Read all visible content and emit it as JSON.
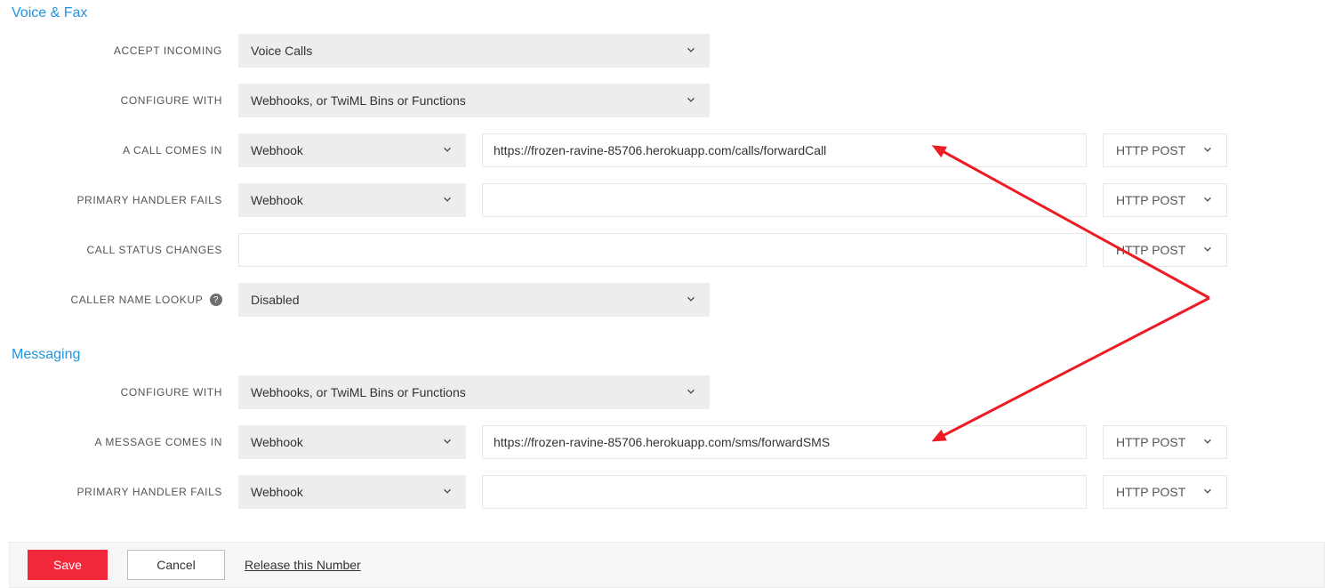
{
  "voice": {
    "title": "Voice & Fax",
    "accept_incoming": {
      "label": "ACCEPT INCOMING",
      "value": "Voice Calls"
    },
    "configure_with": {
      "label": "CONFIGURE WITH",
      "value": "Webhooks, or TwiML Bins or Functions"
    },
    "call_comes_in": {
      "label": "A CALL COMES IN",
      "type": "Webhook",
      "url": "https://frozen-ravine-85706.herokuapp.com/calls/forwardCall",
      "method": "HTTP POST"
    },
    "primary_handler_fails": {
      "label": "PRIMARY HANDLER FAILS",
      "type": "Webhook",
      "url": "",
      "method": "HTTP POST"
    },
    "call_status_changes": {
      "label": "CALL STATUS CHANGES",
      "url": "",
      "method": "HTTP POST"
    },
    "caller_name_lookup": {
      "label": "CALLER NAME LOOKUP",
      "value": "Disabled"
    }
  },
  "messaging": {
    "title": "Messaging",
    "configure_with": {
      "label": "CONFIGURE WITH",
      "value": "Webhooks, or TwiML Bins or Functions"
    },
    "message_comes_in": {
      "label": "A MESSAGE COMES IN",
      "type": "Webhook",
      "url": "https://frozen-ravine-85706.herokuapp.com/sms/forwardSMS",
      "method": "HTTP POST"
    },
    "primary_handler_fails": {
      "label": "PRIMARY HANDLER FAILS",
      "type": "Webhook",
      "url": "",
      "method": "HTTP POST"
    }
  },
  "footer": {
    "save": "Save",
    "cancel": "Cancel",
    "release": "Release this Number"
  }
}
